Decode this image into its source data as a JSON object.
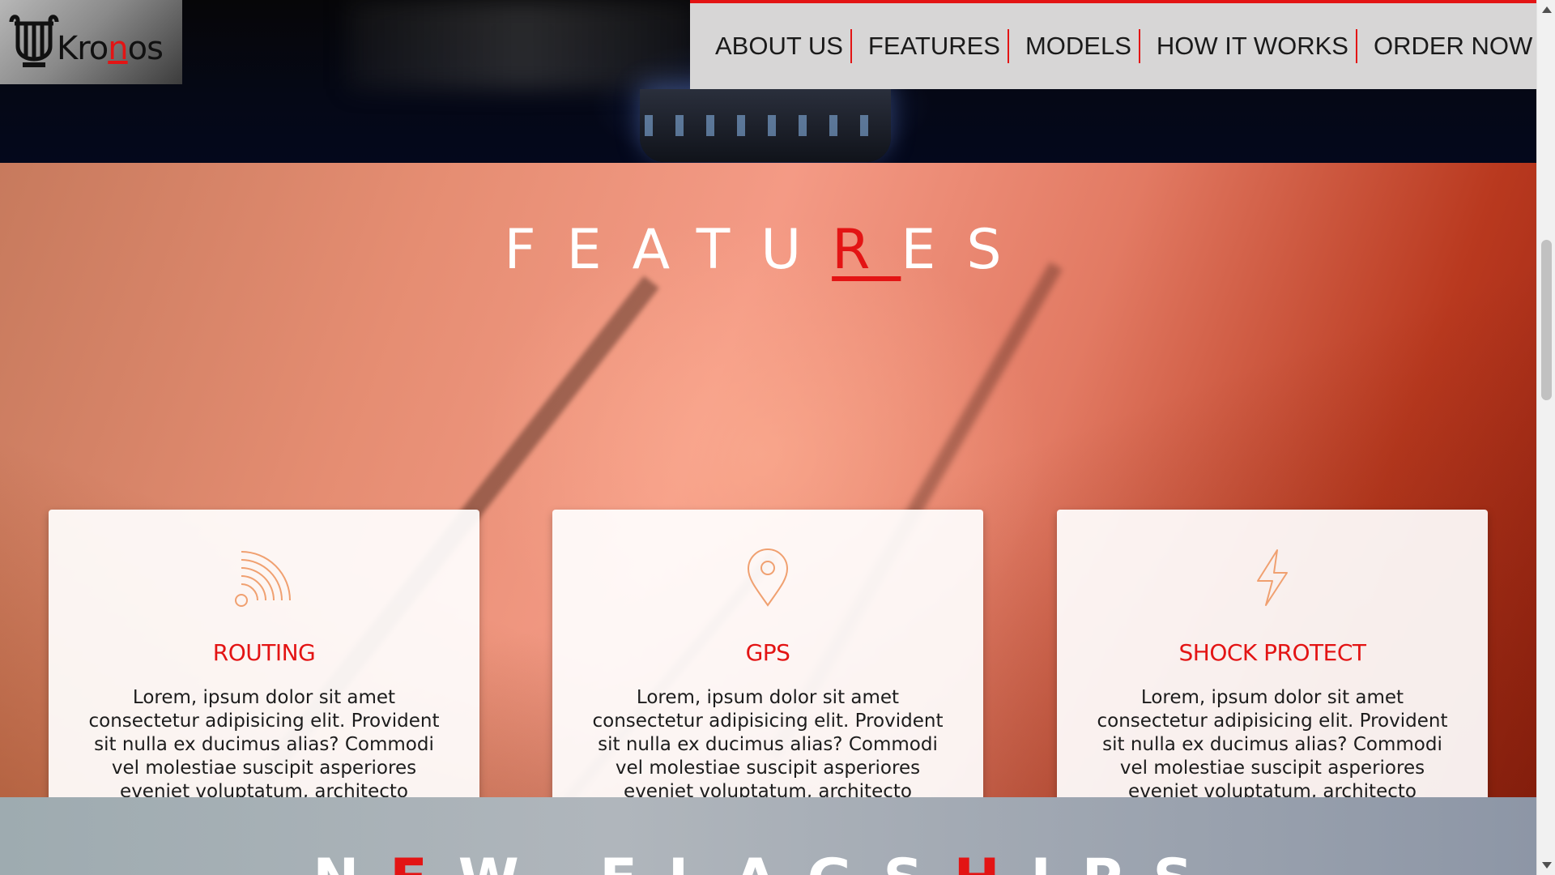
{
  "logo": {
    "text_before": "Kro",
    "text_accent": "n",
    "text_after": "os",
    "icon": "lyre-logo-icon"
  },
  "nav": {
    "items": [
      {
        "label": "ABOUT US"
      },
      {
        "label": "FEATURES"
      },
      {
        "label": "MODELS"
      },
      {
        "label": "HOW IT WORKS"
      },
      {
        "label": "ORDER NOW"
      }
    ]
  },
  "features": {
    "title_before": "FEATU",
    "title_accent": "R",
    "title_after": "ES",
    "cards": [
      {
        "icon": "wifi-signal-icon",
        "title": "ROUTING",
        "text": "Lorem, ipsum dolor sit amet consectetur adipisicing elit. Provident sit nulla ex ducimus alias? Commodi vel molestiae suscipit asperiores eveniet voluptatum, architecto voluptatem, mollitia odio explicabo temporibus ipsam, saepe error!"
      },
      {
        "icon": "map-pin-icon",
        "title": "GPS",
        "text": "Lorem, ipsum dolor sit amet consectetur adipisicing elit. Provident sit nulla ex ducimus alias? Commodi vel molestiae suscipit asperiores eveniet voluptatum, architecto voluptatem, mollitia odio explicabo temporibus ipsam, saepe error!"
      },
      {
        "icon": "lightning-bolt-icon",
        "title": "SHOCK PROTECT",
        "text": "Lorem, ipsum dolor sit amet consectetur adipisicing elit. Provident sit nulla ex ducimus alias? Commodi vel molestiae suscipit asperiores eveniet voluptatum, architecto voluptatem, mollitia odio explicabo temporibus ipsam, saepe error!"
      }
    ]
  },
  "flagships": {
    "title_part1": "N",
    "title_part2": "E",
    "title_part3": "W FLAGS",
    "title_part4": "H",
    "title_part5": "IPS"
  },
  "colors": {
    "accent": "#e31414",
    "nav_bg": "#d7d6d6",
    "icon": "#f0a070"
  }
}
